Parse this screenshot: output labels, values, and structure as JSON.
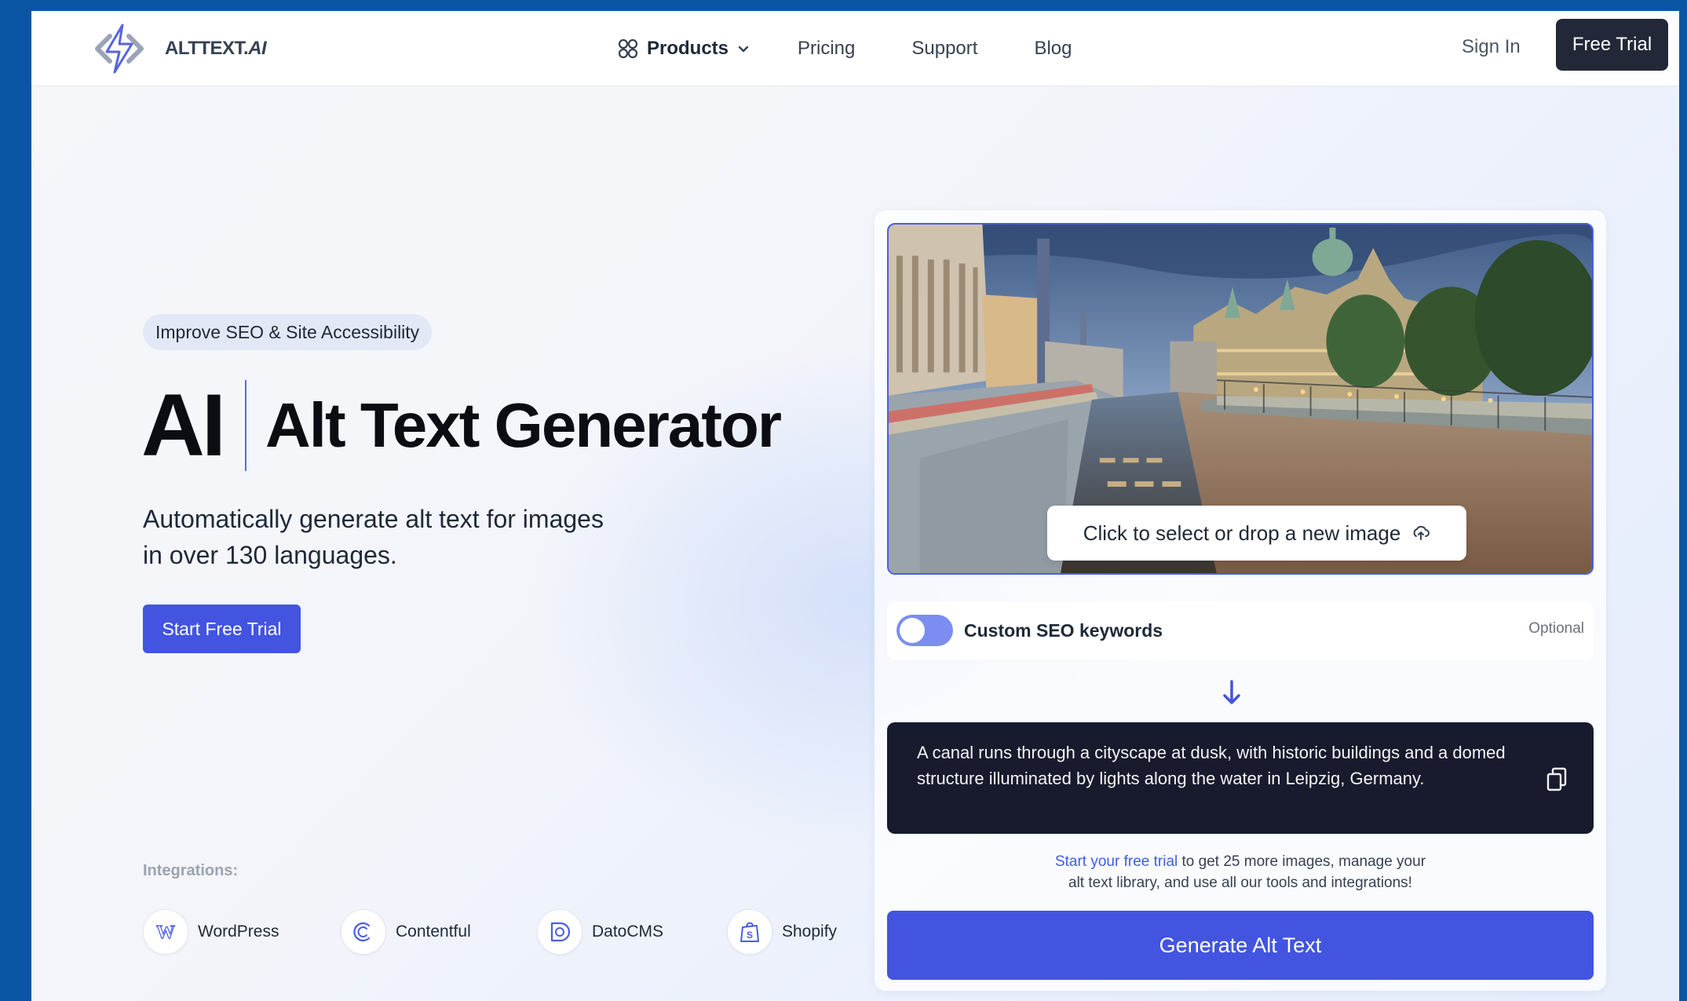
{
  "nav": {
    "logo_text": "ALTTEXT.",
    "logo_text_ai": "AI",
    "products_label": "Products",
    "pricing_label": "Pricing",
    "support_label": "Support",
    "blog_label": "Blog",
    "sign_in_label": "Sign In",
    "free_trial_label": "Free Trial"
  },
  "hero": {
    "badge": "Improve SEO & Site Accessibility",
    "title_ai": "AI",
    "title_rest": "Alt Text Generator",
    "subtitle_line1": "Automatically generate alt text for images",
    "subtitle_line2": "in over 130 languages.",
    "cta_label": "Start Free Trial",
    "integrations_label": "Integrations:",
    "integrations": [
      {
        "name": "WordPress",
        "icon": "wordpress-icon"
      },
      {
        "name": "Contentful",
        "icon": "contentful-icon"
      },
      {
        "name": "DatoCMS",
        "icon": "datocms-icon"
      },
      {
        "name": "Shopify",
        "icon": "shopify-icon"
      }
    ]
  },
  "card": {
    "drop_label": "Click to select or drop a new image",
    "seo_label": "Custom SEO keywords",
    "optional_label": "Optional",
    "result_text": "A canal runs through a cityscape at dusk, with historic buildings and a domed structure illuminated by lights along the water in Leipzig, Germany.",
    "promo_link": "Start your free trial",
    "promo_rest_line1": " to get 25 more images, manage your",
    "promo_line2": "alt text library, and use all our tools and integrations!",
    "generate_label": "Generate Alt Text"
  },
  "colors": {
    "accent": "#4254e0",
    "dark": "#171b2d",
    "frame": "#0a56a5"
  }
}
